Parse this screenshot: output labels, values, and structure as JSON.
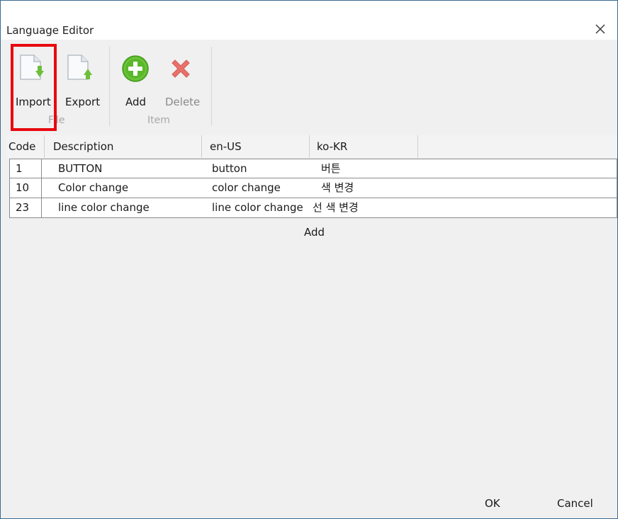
{
  "window": {
    "title": "Language Editor"
  },
  "toolbar": {
    "groups": [
      {
        "label": "File",
        "buttons": [
          {
            "label": "Import",
            "icon": "import-document-icon"
          },
          {
            "label": "Export",
            "icon": "export-document-icon"
          }
        ]
      },
      {
        "label": "Item",
        "buttons": [
          {
            "label": "Add",
            "icon": "add-circle-icon"
          },
          {
            "label": "Delete",
            "icon": "delete-x-icon"
          }
        ]
      }
    ]
  },
  "grid": {
    "columns": [
      "Code",
      "Description",
      "en-US",
      "ko-KR"
    ],
    "rows": [
      {
        "code": "1",
        "description": "BUTTON",
        "en": "button",
        "ko": "버튼"
      },
      {
        "code": "10",
        "description": "Color change",
        "en": "color change",
        "ko": "색 변경"
      },
      {
        "code": "23",
        "description": "line color change",
        "en": "line color change",
        "ko": "선 색 변경"
      }
    ],
    "add_label": "Add"
  },
  "footer": {
    "ok_label": "OK",
    "cancel_label": "Cancel"
  },
  "colors": {
    "highlight": "#e8090f",
    "add_green": "#5ab82a",
    "delete_red": "#e0554e",
    "window_border": "#3c6b93"
  }
}
